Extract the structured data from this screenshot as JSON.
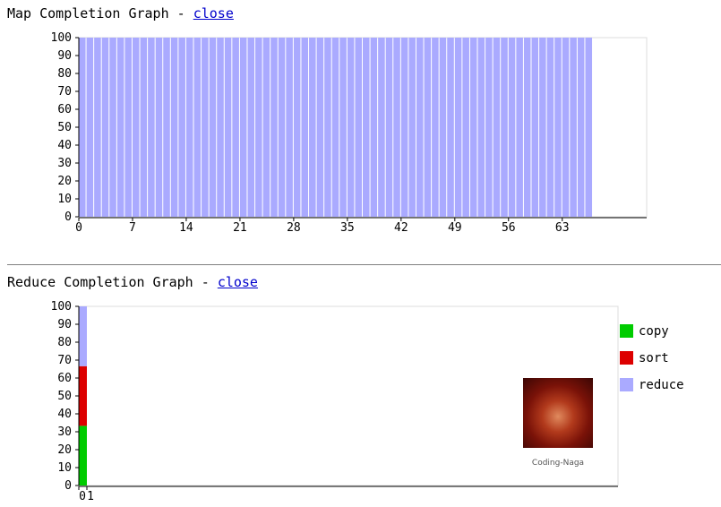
{
  "map_section": {
    "title": "Map Completion Graph - ",
    "close_label": "close"
  },
  "reduce_section": {
    "title": "Reduce Completion Graph - ",
    "close_label": "close"
  },
  "watermark": {
    "label": "Coding-Naga"
  },
  "chart_data": [
    {
      "type": "bar",
      "task_count": 67,
      "values": [
        100,
        100,
        100,
        100,
        100,
        100,
        100,
        100,
        100,
        100,
        100,
        100,
        100,
        100,
        100,
        100,
        100,
        100,
        100,
        100,
        100,
        100,
        100,
        100,
        100,
        100,
        100,
        100,
        100,
        100,
        100,
        100,
        100,
        100,
        100,
        100,
        100,
        100,
        100,
        100,
        100,
        100,
        100,
        100,
        100,
        100,
        100,
        100,
        100,
        100,
        100,
        100,
        100,
        100,
        100,
        100,
        100,
        100,
        100,
        100,
        100,
        100,
        100,
        100,
        100,
        100,
        100
      ],
      "x_ticks": [
        0,
        7,
        14,
        21,
        28,
        35,
        42,
        49,
        56,
        63
      ],
      "y_ticks": [
        0,
        10,
        20,
        30,
        40,
        50,
        60,
        70,
        80,
        90,
        100
      ],
      "ylim": [
        0,
        100
      ],
      "xlim": [
        0,
        74
      ],
      "color": "#aaaaff",
      "grid": false
    },
    {
      "type": "bar",
      "stacked": true,
      "categories": [
        "0"
      ],
      "x_tick_labels": [
        "0",
        "1"
      ],
      "series": [
        {
          "name": "copy",
          "values": [
            33.3
          ],
          "color": "#00cc00"
        },
        {
          "name": "sort",
          "values": [
            33.3
          ],
          "color": "#dd0000"
        },
        {
          "name": "reduce",
          "values": [
            33.4
          ],
          "color": "#aaaaff"
        }
      ],
      "y_ticks": [
        0,
        10,
        20,
        30,
        40,
        50,
        60,
        70,
        80,
        90,
        100
      ],
      "ylim": [
        0,
        100
      ],
      "xlim": [
        0,
        1
      ],
      "legend": "right",
      "grid": false
    }
  ]
}
